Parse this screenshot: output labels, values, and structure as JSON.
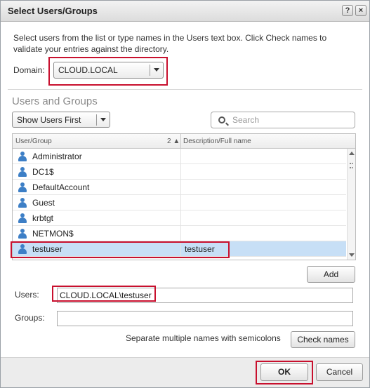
{
  "window": {
    "title": "Select Users/Groups",
    "help_glyph": "?",
    "close_glyph": "×"
  },
  "instructions": "Select users from the list or type names in the Users text box. Click Check names to validate your entries against the directory.",
  "domain": {
    "label": "Domain:",
    "selected": "CLOUD.LOCAL"
  },
  "section_title": "Users and Groups",
  "filter": {
    "selected": "Show Users First"
  },
  "search": {
    "placeholder": "Search"
  },
  "table": {
    "columns": [
      "User/Group",
      "Description/Full name"
    ],
    "sort_indicator": "2 ▲",
    "rows": [
      {
        "name": "Administrator",
        "description": ""
      },
      {
        "name": "DC1$",
        "description": ""
      },
      {
        "name": "DefaultAccount",
        "description": ""
      },
      {
        "name": "Guest",
        "description": ""
      },
      {
        "name": "krbtgt",
        "description": ""
      },
      {
        "name": "NETMON$",
        "description": ""
      },
      {
        "name": "testuser",
        "description": "testuser",
        "selected": true
      }
    ]
  },
  "buttons": {
    "add": "Add",
    "check_names": "Check names",
    "ok": "OK",
    "cancel": "Cancel"
  },
  "users_field": {
    "label": "Users:",
    "value": "CLOUD.LOCAL\\testuser"
  },
  "groups_field": {
    "label": "Groups:",
    "value": ""
  },
  "hint": "Separate multiple names with semicolons",
  "colors": {
    "highlight": "#c8102e",
    "selected_row": "#c7dff6",
    "user_icon": "#3d7fc6"
  },
  "icons": {
    "user": "user-icon",
    "search": "search-icon"
  }
}
